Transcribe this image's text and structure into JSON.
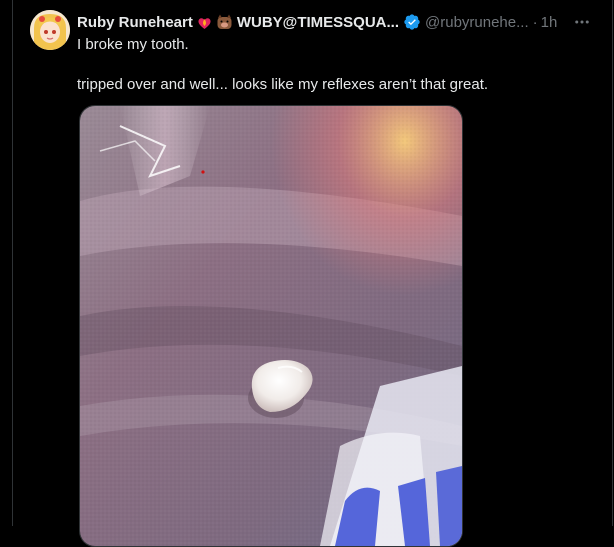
{
  "post": {
    "author": {
      "display_name": "Ruby Runeheart",
      "badges": [
        "flame-heart-emoji",
        "boar-emoji"
      ],
      "secondary_name": "WUBY@TIMESSQUA...",
      "verified": true,
      "handle": "@rubyrunehe...",
      "separator": "·",
      "time": "1h"
    },
    "text": {
      "line1": "I broke my tooth.",
      "line2": "tripped over and well... looks like my reflexes aren’t that great."
    },
    "media": {
      "type": "photo",
      "subject": "broken-tooth-on-fabric"
    },
    "more_icon": "more-horizontal-icon"
  },
  "colors": {
    "background": "#000000",
    "text": "#e7e9ea",
    "secondary_text": "#71767b",
    "verified": "#1d9bf0",
    "border": "#2f3336"
  }
}
